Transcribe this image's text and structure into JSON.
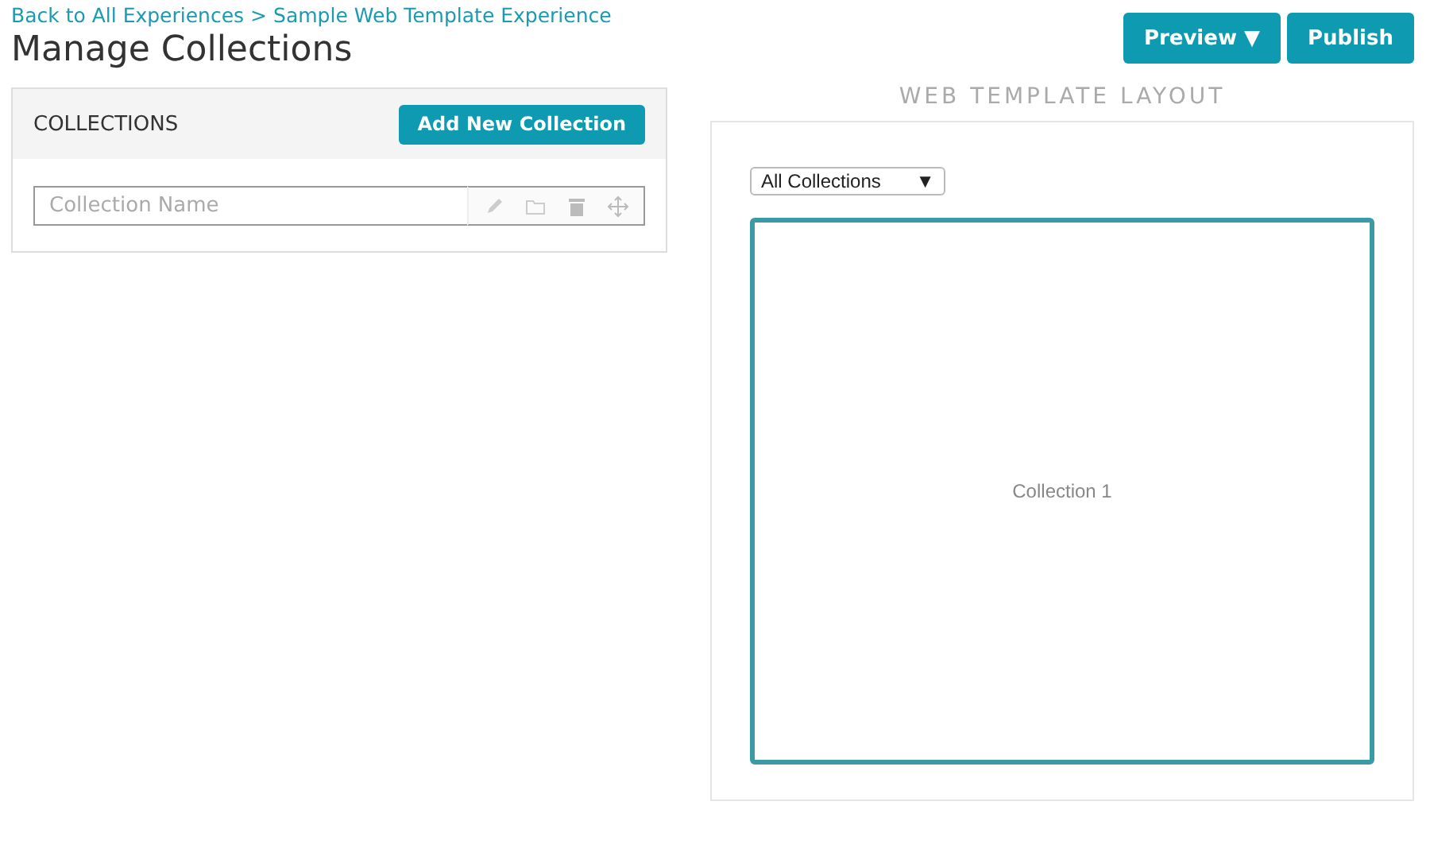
{
  "breadcrumb": {
    "items": [
      "Back to All Experiences",
      "Sample Web Template Experience"
    ],
    "separator": ">"
  },
  "page_title": "Manage Collections",
  "header_buttons": [
    {
      "label": "Preview ▼"
    },
    {
      "label": "Publish"
    }
  ],
  "collections_panel": {
    "title": "COLLECTIONS",
    "add_button": "Add New Collection",
    "name_field": {
      "placeholder": "Collection Name"
    }
  },
  "layout_panel": {
    "title": "WEB TEMPLATE LAYOUT",
    "filter": {
      "value": "All Collections",
      "caret": "▼"
    },
    "collections": [
      {
        "label": "Collection 1"
      }
    ]
  }
}
